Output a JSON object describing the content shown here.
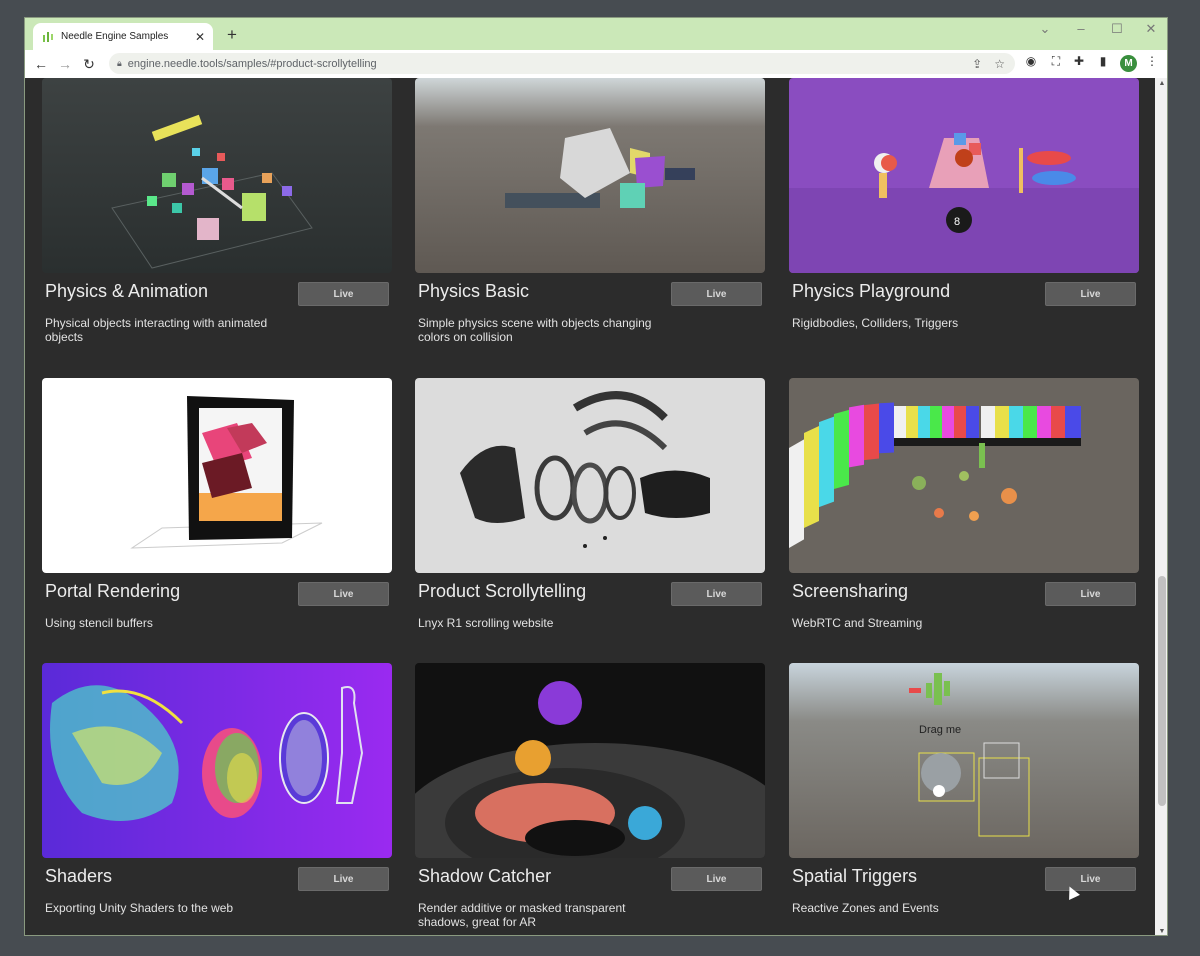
{
  "browser": {
    "tab_title": "Needle Engine Samples",
    "url": "engine.needle.tools/samples/#product-scrollytelling",
    "avatar_initial": "M"
  },
  "colors": {
    "accent": "#cbe8b8",
    "page_background": "#2c2c2c",
    "live_button": "#5b5b5b"
  },
  "samples": [
    {
      "title": "Physics & Animation",
      "live_label": "Live",
      "description": "Physical objects interacting with animated objects"
    },
    {
      "title": "Physics Basic",
      "live_label": "Live",
      "description": "Simple physics scene with objects changing colors on collision"
    },
    {
      "title": "Physics Playground",
      "live_label": "Live",
      "description": "Rigidbodies, Colliders, Triggers"
    },
    {
      "title": "Portal Rendering",
      "live_label": "Live",
      "description": "Using stencil buffers"
    },
    {
      "title": "Product Scrollytelling",
      "live_label": "Live",
      "description": "Lnyx R1 scrolling website"
    },
    {
      "title": "Screensharing",
      "live_label": "Live",
      "description": "WebRTC and Streaming"
    },
    {
      "title": "Shaders",
      "live_label": "Live",
      "description": "Exporting Unity Shaders to the web"
    },
    {
      "title": "Shadow Catcher",
      "live_label": "Live",
      "description": "Render additive or masked transparent shadows, great for AR"
    },
    {
      "title": "Spatial Triggers",
      "live_label": "Live",
      "description": "Reactive Zones and Events",
      "thumbnail_text": "Drag me"
    }
  ]
}
